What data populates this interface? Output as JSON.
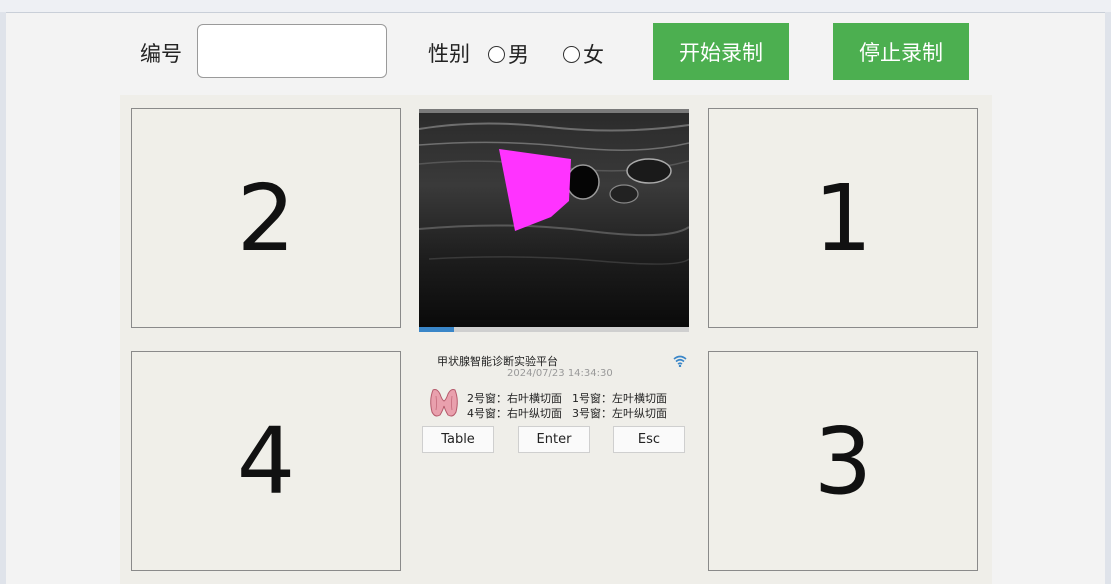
{
  "header": {
    "id_label": "编号",
    "id_value": "",
    "gender_label": "性别",
    "gender_options": [
      "男",
      "女"
    ],
    "start_button": "开始录制",
    "stop_button": "停止录制"
  },
  "grid": {
    "top_left": "2",
    "top_right": "1",
    "bottom_left": "4",
    "bottom_right": "3"
  },
  "playback": {
    "progress_fraction": 0.13
  },
  "info": {
    "title": "甲状腺智能诊断实验平台",
    "timestamp": "2024/07/23 14:34:30",
    "lines": [
      [
        "2号窗：右叶横切面",
        "1号窗：左叶横切面"
      ],
      [
        "4号窗：右叶纵切面",
        "3号窗：左叶纵切面"
      ]
    ]
  },
  "buttons": {
    "table": "Table",
    "enter": "Enter",
    "esc": "Esc"
  },
  "colors": {
    "button_green": "#4caf50",
    "segmentation": "#ff33ff"
  }
}
